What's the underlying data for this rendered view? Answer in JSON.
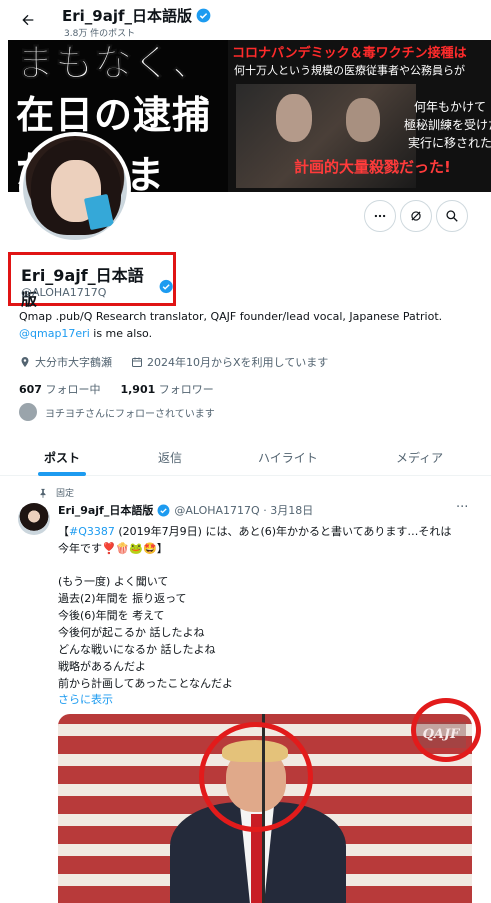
{
  "header": {
    "name": "Eri_9ajf_日本語版",
    "posts_count": "3.8万 件のポスト"
  },
  "banner": {
    "line1": "まもなく、",
    "line2": "在日の逮捕が",
    "line3": "まる。",
    "red_top": "コロナパンデミック＆毒ワクチン接種は",
    "white_top": "何十万人という規模の医療従事者や公務員らが",
    "white_mid1": "何年もかけて",
    "white_mid2": "極秘訓練を受けた後",
    "white_mid3": "実行に移された",
    "green_bottom": "計画的大量殺戮だった!"
  },
  "profile": {
    "display_name": "Eri_9ajf_日本語版",
    "handle": "@ALOHA1717Q",
    "bio_line1": "Qmap .pub/Q Research translator,  QAJF founder/lead vocal, Japanese Patriot.",
    "bio_link": "@qmap17eri",
    "bio_line2_rest": " is me also.",
    "location": "大分市大字鶴瀬",
    "joined": "2024年10月からXを利用しています",
    "following_count": "607",
    "following_label": "フォロー中",
    "followers_count": "1,901",
    "followers_label": "フォロワー",
    "followed_by": "ヨチヨチさんにフォローされています"
  },
  "tabs": [
    "ポスト",
    "返信",
    "ハイライト",
    "メディア"
  ],
  "tweet": {
    "pinned_label": "固定",
    "author": "Eri_9ajf_日本語版",
    "handle_date": "@ALOHA1717Q · 3月18日",
    "line1_prefix": "【",
    "line1_tag": "#Q3387",
    "line1_rest": " (2019年7月9日) には、あと(6)年かかると書いてあります…それは",
    "line2": "今年です❣️🍿🐸🤩】",
    "line3": "(もう一度) よく聞いて",
    "line4": "過去(2)年間を 振り返って",
    "line5": "今後(6)年間を 考えて",
    "line6": "今後何が起こるか 話したよね",
    "line7": "どんな戦いになるか 話したよね",
    "line8": "戦略があるんだよ",
    "line9": "前から計画してあったことなんだよ",
    "show_more": "さらに表示",
    "watermark": "QAJF"
  },
  "colors": {
    "accent": "#1d9bf0",
    "highlight_red": "#e21b1b",
    "text_secondary": "#536471"
  }
}
